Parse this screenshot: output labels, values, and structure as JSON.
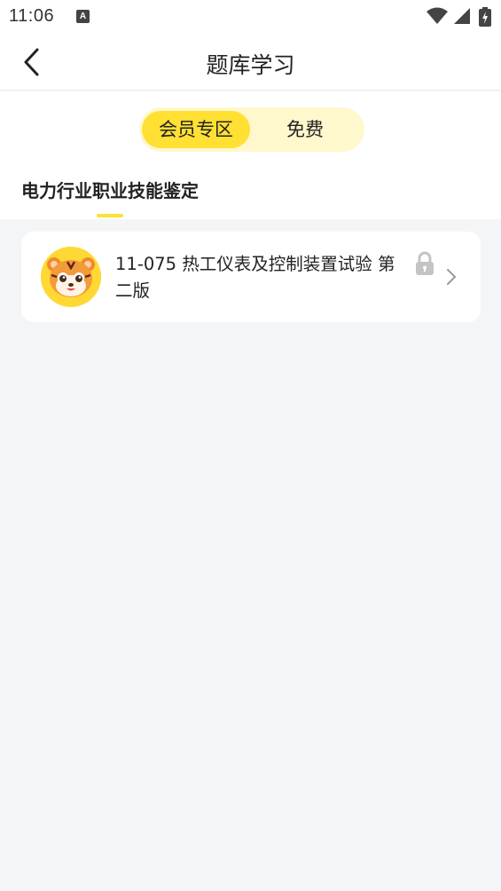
{
  "status_bar": {
    "time": "11:06",
    "notification_badge": "A",
    "icons": [
      "wifi-icon",
      "signal-icon",
      "battery-charging-icon"
    ]
  },
  "header": {
    "title": "题库学习",
    "back_icon": "chevron-left-icon"
  },
  "segment": {
    "items": [
      {
        "label": "会员专区",
        "active": true
      },
      {
        "label": "免费",
        "active": false
      }
    ],
    "active_color": "#ffe033",
    "background_color": "#fff8cc"
  },
  "category": {
    "label": "电力行业职业技能鉴定"
  },
  "bank_list": [
    {
      "title": "11-075 热工仪表及控制装置试验 第二版",
      "avatar_icon": "tiger-mascot-icon",
      "locked": true,
      "lock_icon": "lock-icon",
      "arrow_icon": "chevron-right-icon"
    }
  ]
}
